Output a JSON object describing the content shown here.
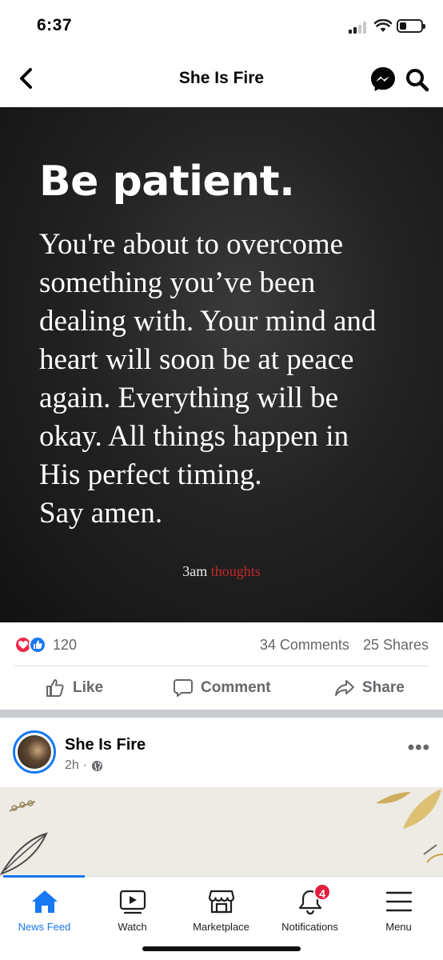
{
  "status_bar": {
    "time": "6:37"
  },
  "header": {
    "title": "She Is Fire",
    "icons": [
      "back-chevron-icon",
      "messenger-icon",
      "search-icon"
    ]
  },
  "post": {
    "image_text": {
      "headline": "Be patient.",
      "lines": [
        "You're about to overcome",
        "something you’ve been",
        "dealing with. Your mind and",
        "heart will soon be at peace",
        "again. Everything will be",
        "okay. All things happen in",
        "His perfect timing.",
        "Say amen."
      ],
      "brand_white": "3am",
      "brand_red": "thoughts"
    },
    "reactions_count": "120",
    "comments": "34 Comments",
    "shares": "25 Shares",
    "actions": {
      "like": "Like",
      "comment": "Comment",
      "share": "Share"
    }
  },
  "post2": {
    "author": "She Is Fire",
    "time": "2h",
    "more": "•••"
  },
  "tabbar": {
    "tabs": [
      {
        "label": "News Feed",
        "icon": "home-icon",
        "active": true
      },
      {
        "label": "Watch",
        "icon": "watch-icon"
      },
      {
        "label": "Marketplace",
        "icon": "marketplace-icon"
      },
      {
        "label": "Notifications",
        "icon": "bell-icon",
        "badge": "4"
      },
      {
        "label": "Menu",
        "icon": "menu-icon"
      }
    ]
  },
  "colors": {
    "accent": "#1877f2",
    "love": "#f0284a",
    "badge": "#e41e3f",
    "brand_red": "#c62828"
  }
}
